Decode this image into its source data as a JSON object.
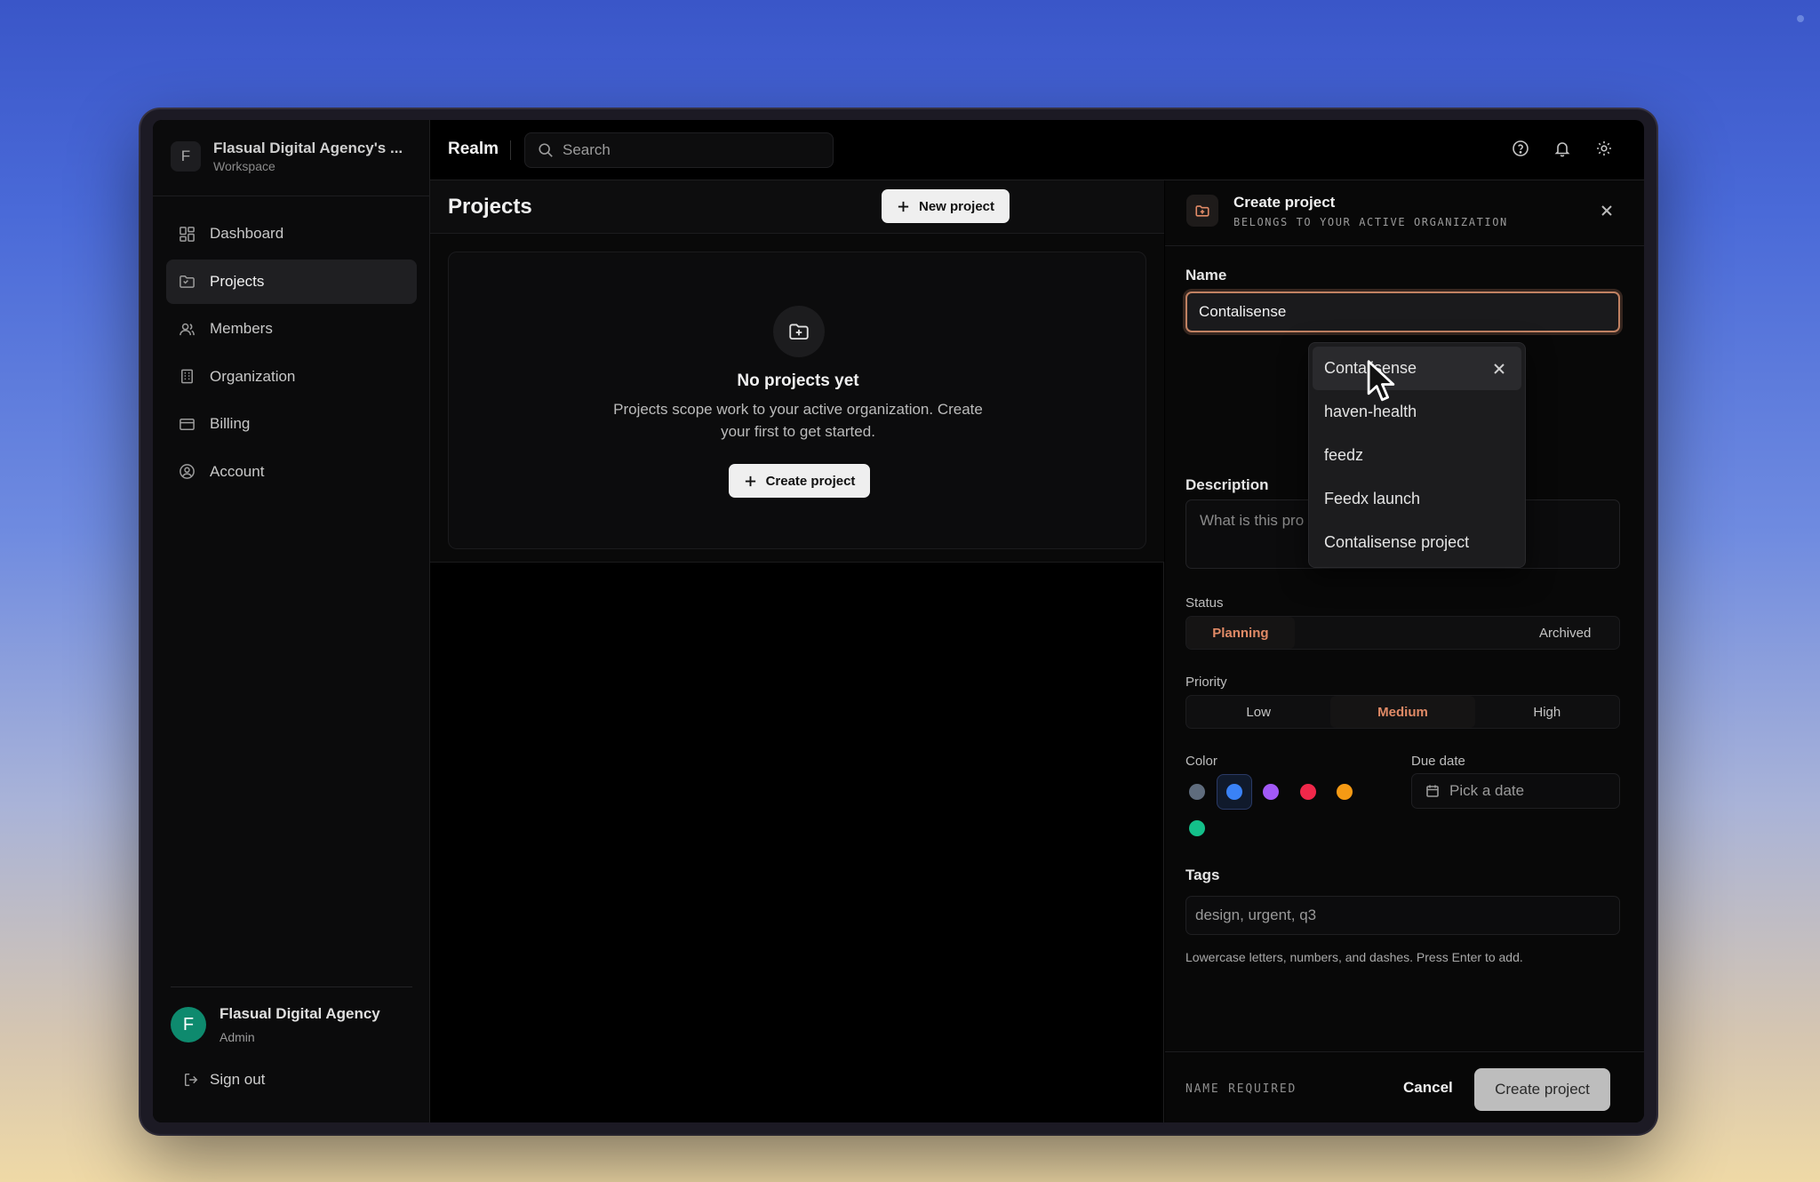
{
  "workspace": {
    "badge": "F",
    "name": "Flasual Digital Agency's ...",
    "sub": "Workspace"
  },
  "nav": [
    {
      "label": "Dashboard",
      "icon": "dashboard-icon"
    },
    {
      "label": "Projects",
      "icon": "folder-icon",
      "active": true
    },
    {
      "label": "Members",
      "icon": "users-icon"
    },
    {
      "label": "Organization",
      "icon": "building-icon"
    },
    {
      "label": "Billing",
      "icon": "card-icon"
    },
    {
      "label": "Account",
      "icon": "user-circle-icon"
    }
  ],
  "user": {
    "initial": "F",
    "name": "Flasual Digital Agency",
    "role": "Admin"
  },
  "signout": "Sign out",
  "topbar": {
    "brand": "Realm",
    "search_placeholder": "Search"
  },
  "main": {
    "title": "Projects",
    "new_project": "New project",
    "empty_title": "No projects yet",
    "empty_desc": "Projects scope work to your active organization. Create your first to get started.",
    "create_project": "Create project"
  },
  "panel": {
    "title": "Create project",
    "subtitle": "BELONGS TO YOUR ACTIVE ORGANIZATION",
    "name_label": "Name",
    "name_value": "Contalisense",
    "description_label": "Description",
    "description_placeholder": "What is this pro",
    "status_label": "Status",
    "status_options": [
      "Planning",
      "",
      "",
      "Archived"
    ],
    "status_selected": "Planning",
    "priority_label": "Priority",
    "priority_options": [
      "Low",
      "Medium",
      "High"
    ],
    "priority_selected": "Medium",
    "color_label": "Color",
    "colors": [
      "#5f6c7d",
      "#3a82f6",
      "#a259f7",
      "#f0284a",
      "#f59a14",
      "#14c08a"
    ],
    "color_selected": "#3a82f6",
    "due_label": "Due date",
    "due_placeholder": "Pick a date",
    "tags_label": "Tags",
    "tags_placeholder": "design, urgent, q3",
    "tags_hint": "Lowercase letters, numbers, and dashes. Press Enter to add.",
    "footer_status": "NAME REQUIRED",
    "cancel": "Cancel",
    "create": "Create project"
  },
  "autocomplete": [
    "Contalisense",
    "haven-health",
    "feedz",
    "Feedx launch",
    "Contalisense project"
  ]
}
